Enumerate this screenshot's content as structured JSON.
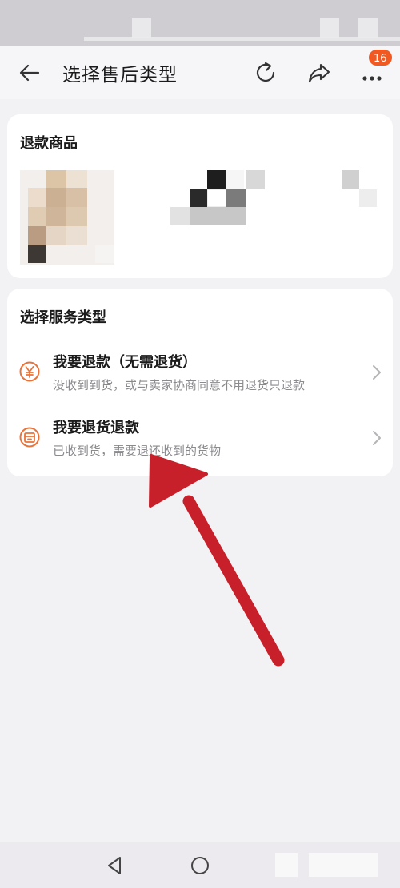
{
  "header": {
    "title": "选择售后类型",
    "more_badge": "16"
  },
  "refund_goods": {
    "title": "退款商品"
  },
  "service_type": {
    "title": "选择服务类型",
    "options": [
      {
        "title": "我要退款（无需退货）",
        "desc": "没收到到货，或与卖家协商同意不用退货只退款",
        "icon": "yen-icon"
      },
      {
        "title": "我要退货退款",
        "desc": "已收到货，需要退还收到的货物",
        "icon": "return-goods-icon"
      }
    ]
  },
  "colors": {
    "accent": "#f05a22",
    "option_icon": "#e8743b",
    "annotation_arrow": "#c8202a",
    "background": "#f2f1f4",
    "card": "#ffffff"
  }
}
